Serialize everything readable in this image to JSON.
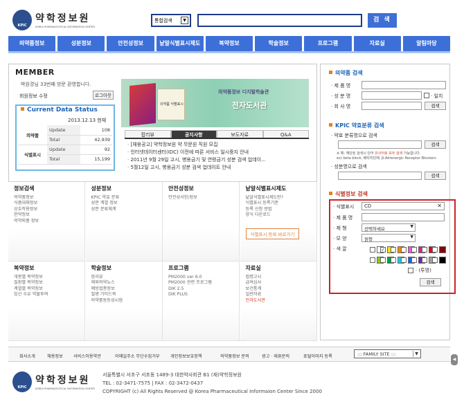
{
  "header": {
    "logo_seal": "KPIC",
    "logo_ko": "약학정보원",
    "logo_en": "KOREA PHARMACEUTICAL INFORMATION CENTER",
    "search_select": "통합검색",
    "search_button": "검 색"
  },
  "nav": [
    "의약품정보",
    "성분정보",
    "안전성정보",
    "낱알식별표시제도",
    "복약정보",
    "학술정보",
    "프로그램",
    "자료실",
    "알림마당"
  ],
  "member": {
    "title": "MEMBER",
    "welcome": "박원경님 33번째 방문 환영합니다.",
    "info": "회원정보 수정",
    "logout": "로그아웃"
  },
  "status": {
    "title": "Current Data Status",
    "date": "2013.12.13 현재",
    "rows": [
      {
        "head": "의약품",
        "label": "Update",
        "value": "108"
      },
      {
        "head": "",
        "label": "Total",
        "value": "42,939"
      },
      {
        "head": "식별표시",
        "label": "Update",
        "value": "92"
      },
      {
        "head": "",
        "label": "Total",
        "value": "15,199"
      }
    ]
  },
  "banner": {
    "subtitle": "의약품정보 디지털학술관",
    "title": "전자도서관",
    "box_label": "의약품 식별표시"
  },
  "tabs": [
    "팝리뷰",
    "공지사항",
    "보도자료",
    "Q&A"
  ],
  "news": [
    "[채용공고] 약학정보원 약 무문원 직원 모집",
    "인터넷데이터센터(IDC) 이전에 따른 서비스 일시중지 안내",
    "2011년 9월 29일 고시, 병용금기 및 연령금기 성분 검색 업데이...",
    "5월12일 고시, 병용금기 성분 검색 업데이트 안내"
  ],
  "cells": [
    {
      "title": "정보검색",
      "lines": [
        "의약품정보",
        "식품대체정보",
        "상호작용정보",
        "한약정보",
        "의약외품 정보"
      ]
    },
    {
      "title": "성분정보",
      "lines": [
        "KPIC 약효 분류",
        "성분 계열 정보",
        "성분 분류체계"
      ]
    },
    {
      "title": "안전성정보",
      "lines": [
        "안전성서한/정보"
      ]
    },
    {
      "title": "낱알식별표시제도",
      "lines": [
        "낱알식별표시제도란?",
        "식별표시 등록기준",
        "등록 신청 방법",
        "양식 다운로드"
      ],
      "button": "식별표시 등록 바로가기"
    },
    {
      "title": "복약정보",
      "lines": [
        "개봉별 복약정보",
        "질환별 복약정보",
        "계열별 복약정보",
        "임신 수유 약물투여"
      ]
    },
    {
      "title": "학술정보",
      "lines": [
        "팜리뷰",
        "해외의약뉴스",
        "예방접종정보",
        "질병 가이드북",
        "의약품동등성시험"
      ]
    },
    {
      "title": "프로그램",
      "lines": [
        "PM2000 ver 6.0",
        "PM2000 관련 프로그램",
        "DIK 2.5",
        "DIK PLUS"
      ]
    },
    {
      "title": "자료실",
      "lines": [
        "법령고시",
        "급여심사",
        "보건통계",
        "일반자료",
        "전자도서관"
      ]
    }
  ],
  "drug_search": {
    "title": "의약품 검색",
    "labels": [
      "제 품 명",
      "성 분 명",
      "회 사 명"
    ],
    "check": "일치",
    "button": "검색"
  },
  "kpic_search": {
    "title": "KPIC 약효분류 검색",
    "lbl1": "약효 분류명으로 검색",
    "note1": "※ 예: 재단된 검색시 단어 ",
    "note_red": "유사어로 모두 검색",
    "note2": " 가능합니다.",
    "note3": "ex) beta block, 베타차단제, β-Adrenergic Receptor Blockers",
    "lbl2": "성분명으로 검색",
    "button": "검색"
  },
  "id_search": {
    "title": "식별정보 검색",
    "labels": [
      "식별표시",
      "제 품 명",
      "제    형",
      "모    양",
      "색    깔"
    ],
    "mark_value": "CD",
    "shape_sel": "선택하세요",
    "form_sel": "원형",
    "transparent": "(투명)",
    "button": "검색",
    "swatches": [
      "#ffffff",
      "#f7e300",
      "#f28a00",
      "#e65bd8",
      "#e61e8a",
      "#e60012",
      "#8b0000",
      "#7fd400",
      "#00a040",
      "#1ec8d8",
      "#2060e0",
      "#7a1fb0",
      "#a0a0a0",
      "#000000"
    ]
  },
  "footer": {
    "links": [
      "회사소개",
      "채용정보",
      "서비스이용약관",
      "이메일주소 무단수집거부",
      "개인정보보호정책",
      "의약품정보 문의",
      "광고 · 제휴문의",
      "포털이미지 등록"
    ],
    "family": "::: FAMILY SITE :::",
    "addr1": "서울특별시 서초구 서초동 1489-3 대한약사회관 B1 (재)약학정보원",
    "addr2": "TEL : 02-3471-7575  |  FAX : 02-3472-0437",
    "addr3": "COPYRIGHT (c) All Rights Reserved @ Korea Pharmaceutical Informaion Center Since 2000",
    "scroll": "◀"
  }
}
